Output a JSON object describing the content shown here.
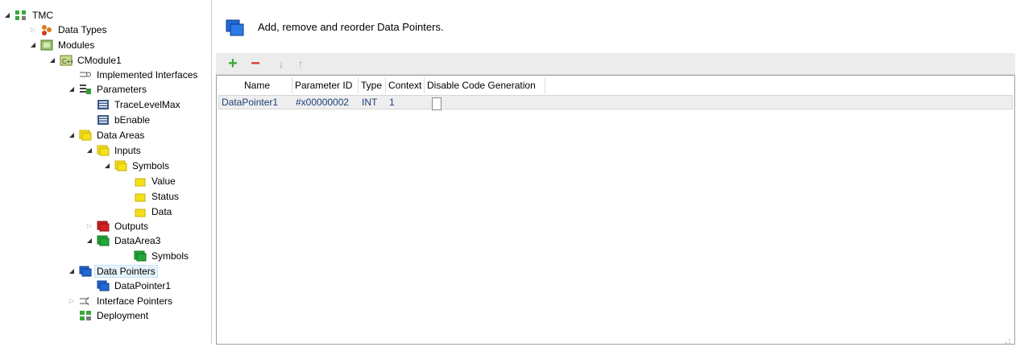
{
  "tree": {
    "root": "TMC",
    "data_types": "Data Types",
    "modules": "Modules",
    "cmodule": "CModule1",
    "implemented_interfaces": "Implemented Interfaces",
    "parameters": "Parameters",
    "trace_level_max": "TraceLevelMax",
    "b_enable": "bEnable",
    "data_areas": "Data Areas",
    "inputs": "Inputs",
    "symbols": "Symbols",
    "value": "Value",
    "status": "Status",
    "data": "Data",
    "outputs": "Outputs",
    "data_area3": "DataArea3",
    "symbols2": "Symbols",
    "data_pointers": "Data Pointers",
    "data_pointer1": "DataPointer1",
    "interface_pointers": "Interface Pointers",
    "deployment": "Deployment"
  },
  "header": {
    "title": "Add, remove and reorder Data Pointers."
  },
  "toolbar": {
    "add_label": "+",
    "remove_label": "−",
    "down_label": "↓",
    "up_label": "↑"
  },
  "grid": {
    "columns": [
      "Name",
      "Parameter ID",
      "Type",
      "Context",
      "Disable Code Generation"
    ],
    "rows": [
      {
        "name": "DataPointer1",
        "parameter_id": "#x00000002",
        "type": "INT",
        "context": "1",
        "disable_code_generation": false
      }
    ]
  },
  "colors": {
    "yellow_folder": "#f5e11a",
    "red_folder": "#d42020",
    "green_folder": "#22a83a",
    "blue_pointer": "#1e6ad6",
    "add_green": "#3aa83a",
    "remove_red": "#d63030"
  }
}
